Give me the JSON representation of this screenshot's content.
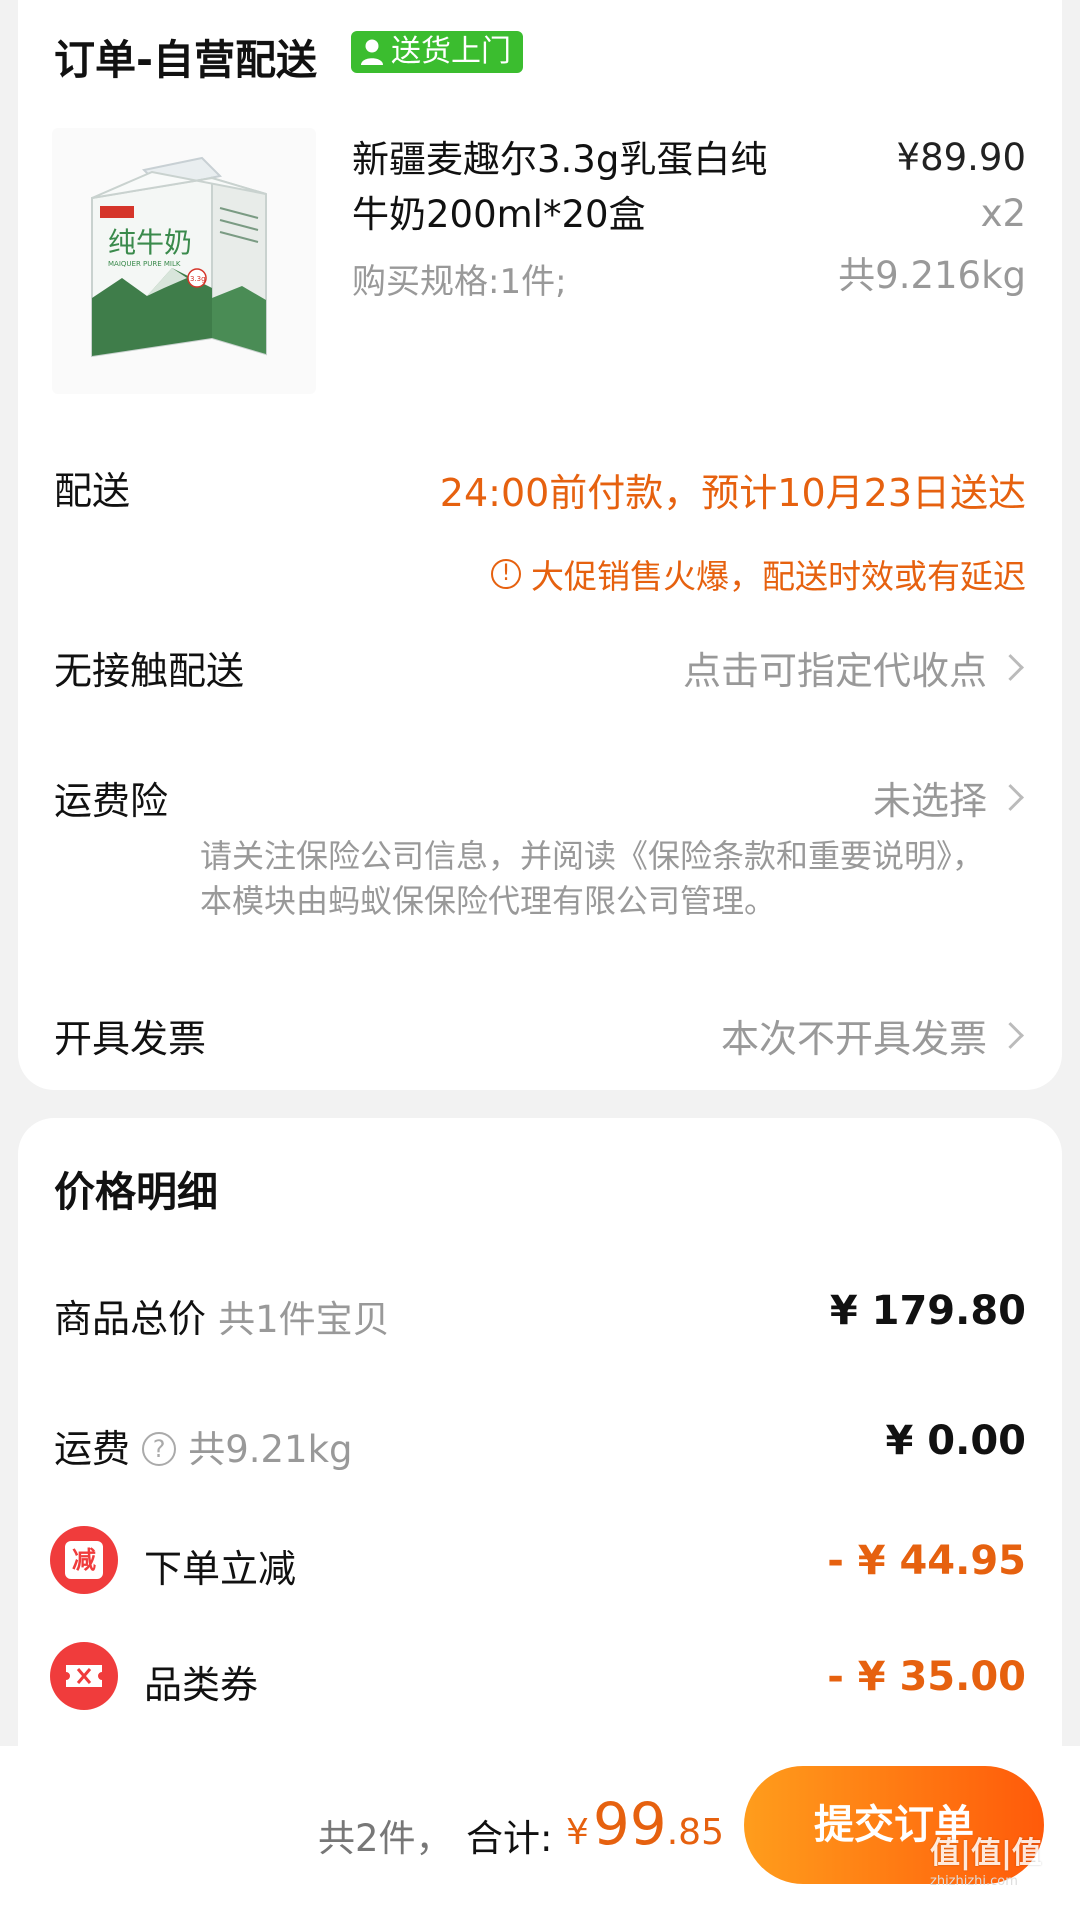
{
  "order": {
    "title": "订单-自营配送",
    "badge": "送货上门",
    "product": {
      "name": "新疆麦趣尔3.3g乳蛋白纯牛奶200ml*20盒",
      "spec": "购买规格:1件;",
      "price": "¥89.90",
      "qty": "x2",
      "weight": "共9.216kg",
      "box_brand": "纯牛奶",
      "box_sub": "MAIQUER PURE MILK",
      "box_tag": "3.3g"
    },
    "delivery": {
      "label": "配送",
      "value": "24:00前付款，预计10月23日送达",
      "warning": "大促销售火爆，配送时效或有延迟"
    },
    "contactless": {
      "label": "无接触配送",
      "value": "点击可指定代收点"
    },
    "insurance": {
      "label": "运费险",
      "value": "未选择",
      "note": "请关注保险公司信息，并阅读《保险条款和重要说明》，本模块由蚂蚁保保险代理有限公司管理。"
    },
    "invoice": {
      "label": "开具发票",
      "value": "本次不开具发票"
    }
  },
  "price_detail": {
    "title": "价格明细",
    "goods_total": {
      "label": "商品总价",
      "sub": "共1件宝贝",
      "value": "¥ 179.80"
    },
    "shipping": {
      "label": "运费",
      "sub": "共9.21kg",
      "value": "¥ 0.00"
    },
    "instant_discount": {
      "label": "下单立减",
      "icon_text": "减",
      "value": "- ¥ 44.95"
    },
    "category_coupon": {
      "label": "品类券",
      "value": "- ¥ 35.00"
    }
  },
  "footer": {
    "count": "共2件，",
    "total_label": "合计:",
    "currency": "¥",
    "total_int": "99",
    "total_dec": ".85",
    "submit": "提交订单",
    "watermark": "值|值|值",
    "watermark_url": "zhizhizhi.com"
  },
  "colors": {
    "accent": "#e6610f",
    "badge_green": "#3bbd2f",
    "discount_red": "#f03c3c"
  }
}
